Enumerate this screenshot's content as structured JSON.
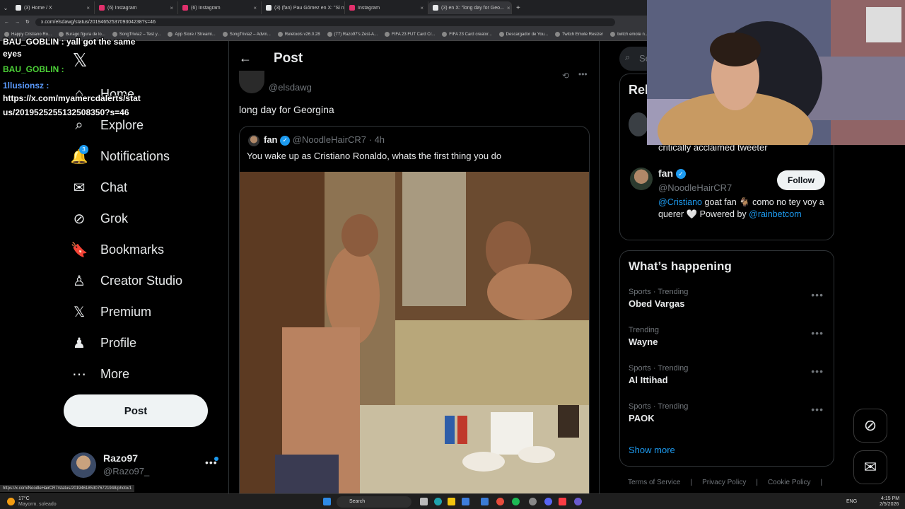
{
  "browser": {
    "tabs": [
      {
        "title": "(3) Home / X",
        "color": "#e7e9ea"
      },
      {
        "title": "(6) Instagram",
        "color": "#e1306c"
      },
      {
        "title": "(6) Instagram",
        "color": "#e1306c"
      },
      {
        "title": "(3) (fan) Pau Gómez en X: \"Si ne...",
        "color": "#e7e9ea"
      },
      {
        "title": "Instagram",
        "color": "#e1306c"
      },
      {
        "title": "(3) en X: \"long day for Geo...",
        "color": "#e7e9ea"
      }
    ],
    "url": "x.com/elsdawg/status/2019465253709304238?s=46",
    "bookmarks": [
      "Happy Cristiano Ro...",
      "Burago figura de lo...",
      "SongTrivia2 – Test y...",
      "App Store / Streami...",
      "SongTrivia2 – Advin...",
      "Reletools v26.0.28",
      "(77) Razo97's Zest-A...",
      "FIFA 23 FUT Card Cr...",
      "FIFA 23 Card creator...",
      "Descargador de You...",
      "Twitch Emote Resizer",
      "twitch emote n..."
    ],
    "status_url": "https://x.com/NoodleHairCR7/status/2019461853076721948/photo/1"
  },
  "chat": {
    "lines": [
      {
        "text": "BAU_GOBLIN : yall got the same",
        "color": "#fff"
      },
      {
        "text": "eyes",
        "color": "#fff"
      },
      {
        "text": "BAU_GOBLIN :",
        "color": "#4cd137"
      },
      {
        "text": "1llusionsz :",
        "color": "#5b9bff"
      },
      {
        "text": "https://x.com/myamercdalerts/stat",
        "color": "#fff"
      },
      {
        "text": "us/2019525255132508350?s=46",
        "color": "#fff"
      }
    ]
  },
  "nav": {
    "items": [
      {
        "label": "Home",
        "icon": "home-icon"
      },
      {
        "label": "Explore",
        "icon": "search-icon"
      },
      {
        "label": "Notifications",
        "icon": "bell-icon",
        "badge": "3"
      },
      {
        "label": "Chat",
        "icon": "mail-icon"
      },
      {
        "label": "Grok",
        "icon": "grok-icon"
      },
      {
        "label": "Bookmarks",
        "icon": "bookmark-icon"
      },
      {
        "label": "Creator Studio",
        "icon": "creator-icon"
      },
      {
        "label": "Premium",
        "icon": "x-icon"
      },
      {
        "label": "Profile",
        "icon": "person-icon"
      },
      {
        "label": "More",
        "icon": "more-icon"
      }
    ],
    "post_label": "Post",
    "account": {
      "name": "Razo97",
      "handle": "@Razo97_"
    }
  },
  "main": {
    "header_title": "Post",
    "author_handle": "@elsdawg",
    "text": "long day for Georgina",
    "quote": {
      "name": "fan",
      "handle": "@NoodleHairCR7",
      "time": "· 4h",
      "text": "You wake up as Cristiano Ronaldo, whats the first thing you do"
    }
  },
  "right": {
    "search_placeholder": "Se",
    "relevant_title": "Rel",
    "prev_bio": "critically acclaimed tweeter",
    "user": {
      "name": "fan",
      "handle": "@NoodleHairCR7",
      "follow_label": "Follow",
      "mention": "@Cristiano",
      "bio": " goat fan 🐐 como no tey voy a querer 🤍 Powered by",
      "link": "@rainbetcom"
    },
    "happening_title": "What’s happening",
    "trends": [
      {
        "category": "Sports · Trending",
        "name": "Obed Vargas"
      },
      {
        "category": "Trending",
        "name": "Wayne"
      },
      {
        "category": "Sports · Trending",
        "name": "Al Ittihad"
      },
      {
        "category": "Sports · Trending",
        "name": "PAOK"
      }
    ],
    "show_more": "Show more",
    "footer": [
      "Terms of Service",
      "Privacy Policy",
      "Cookie Policy"
    ]
  },
  "taskbar": {
    "weather_temp": "17°C",
    "weather_desc": "Mayorm. soleado",
    "search_label": "Search",
    "lang": "ENG",
    "time": "4:15 PM",
    "date": "2/5/2026"
  },
  "colors": {
    "accent": "#1d9bf0",
    "link": "#1d9bf0"
  }
}
